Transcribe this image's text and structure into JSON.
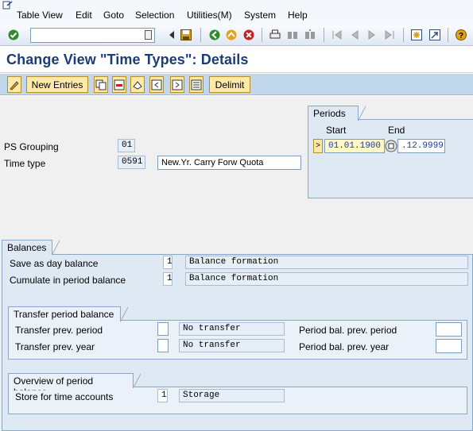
{
  "menubar": {
    "items": [
      "Table View",
      "Edit",
      "Goto",
      "Selection",
      "Utilities(M)",
      "System",
      "Help"
    ]
  },
  "title": "Change View \"Time Types\": Details",
  "app_toolbar": {
    "new_entries": "New Entries",
    "delimit": "Delimit"
  },
  "header": {
    "ps_grouping_label": "PS Grouping",
    "ps_grouping_value": "01",
    "time_type_label": "Time type",
    "time_type_value": "0591",
    "time_type_text": "New.Yr. Carry Forw Quota"
  },
  "periods": {
    "title": "Periods",
    "start_label": "Start",
    "end_label": "End",
    "start_value": "01.01.1900",
    "end_value": ".12.9999"
  },
  "balances": {
    "title": "Balances",
    "rows": [
      {
        "label": "Save as day balance",
        "code": "1",
        "text": "Balance formation"
      },
      {
        "label": "Cumulate in period balance",
        "code": "1",
        "text": "Balance formation"
      }
    ]
  },
  "transfer": {
    "title": "Transfer period balance",
    "prev_period_label": "Transfer prev. period",
    "prev_period_value": "",
    "prev_period_text": "No transfer",
    "prev_year_label": "Transfer prev. year",
    "prev_year_value": "",
    "prev_year_text": "No transfer",
    "pbal_prev_period_label": "Period bal. prev. period",
    "pbal_prev_period_value": "",
    "pbal_prev_year_label": "Period bal. prev. year",
    "pbal_prev_year_value": ""
  },
  "overview": {
    "title": "Overview of period balance",
    "store_label": "Store for time accounts",
    "store_code": "1",
    "store_text": "Storage"
  },
  "colors": {
    "title": "#1c3c78",
    "button_bg": "#fde9a8",
    "group_bg": "#dfe9f4",
    "app_toolbar_bg": "#c0d7ec"
  }
}
